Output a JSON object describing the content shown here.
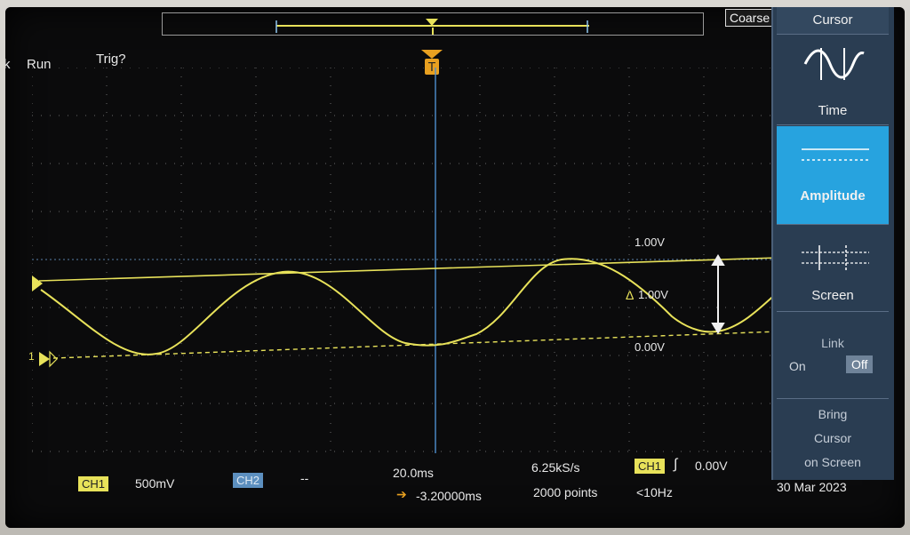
{
  "status": {
    "run": "Run",
    "trig": "Trig?",
    "run_prefix": "k"
  },
  "toolbar": {
    "coarse_label": "Coarse"
  },
  "cursor_menu": {
    "title": "Cursor",
    "items": [
      {
        "label": "Time",
        "selected": false
      },
      {
        "label": "Amplitude",
        "selected": true
      },
      {
        "label": "Screen",
        "selected": false
      }
    ],
    "link": {
      "label": "Link",
      "on_label": "On",
      "off_label": "Off",
      "selected": "Off"
    },
    "bring": {
      "line1": "Bring",
      "line2": "Cursor",
      "line3": "on Screen"
    }
  },
  "cursors": {
    "upper_readout": "1.00V",
    "delta_readout": "1.00V",
    "lower_readout": "0.00V",
    "delta_symbol": "Δ"
  },
  "markers": {
    "ch1_ground": "1",
    "trigger": "T"
  },
  "bottom": {
    "ch1_label": "CH1",
    "ch1_scale": "500mV",
    "ch2_label": "CH2",
    "ch2_scale": "--",
    "timebase": "20.0ms",
    "delay": "-3.20000ms",
    "sample_rate": "6.25kS/s",
    "record_length": "2000 points",
    "trigger_source": "CH1",
    "trigger_slope": "∫",
    "trigger_level": "0.00V",
    "trigger_freq": "<10Hz",
    "date": "30 Mar 2023"
  },
  "colors": {
    "ch1": "#e8e25a",
    "ch2": "#5c8fbf",
    "menu_bg": "#2a3d52",
    "menu_selected": "#27a3df",
    "screen_bg": "#0b0b0c"
  }
}
